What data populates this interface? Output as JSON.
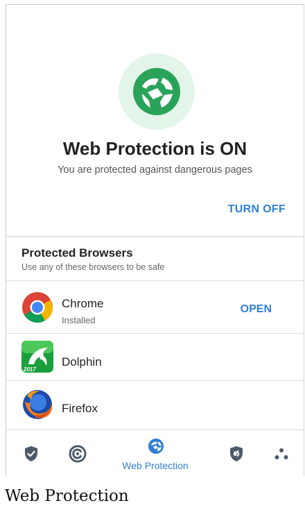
{
  "hero": {
    "title": "Web Protection is ON",
    "subtitle": "You are protected against dangerous pages",
    "turn_off_label": "TURN OFF",
    "icon": "web-protection-globe-icon",
    "icon_color": "#2aa35a",
    "icon_bg": "#e3f4e9"
  },
  "browsers": {
    "title": "Protected Browsers",
    "subtitle": "Use any of these browsers to be safe",
    "items": [
      {
        "name": "Chrome",
        "status": "Installed",
        "action": "OPEN",
        "icon": "chrome-icon"
      },
      {
        "name": "Dolphin",
        "badge": "2017",
        "icon": "dolphin-icon"
      },
      {
        "name": "Firefox",
        "icon": "firefox-icon"
      }
    ]
  },
  "bottom_nav": {
    "items": [
      {
        "icon": "shield-check-icon"
      },
      {
        "icon": "scan-icon"
      },
      {
        "icon": "web-protection-icon",
        "label": "Web Protection",
        "active": true
      },
      {
        "icon": "shield-link-icon"
      },
      {
        "icon": "more-dots-icon"
      }
    ],
    "active_color": "#2e7fd6",
    "inactive_color": "#4e5a6a"
  },
  "caption": "Web Protection"
}
